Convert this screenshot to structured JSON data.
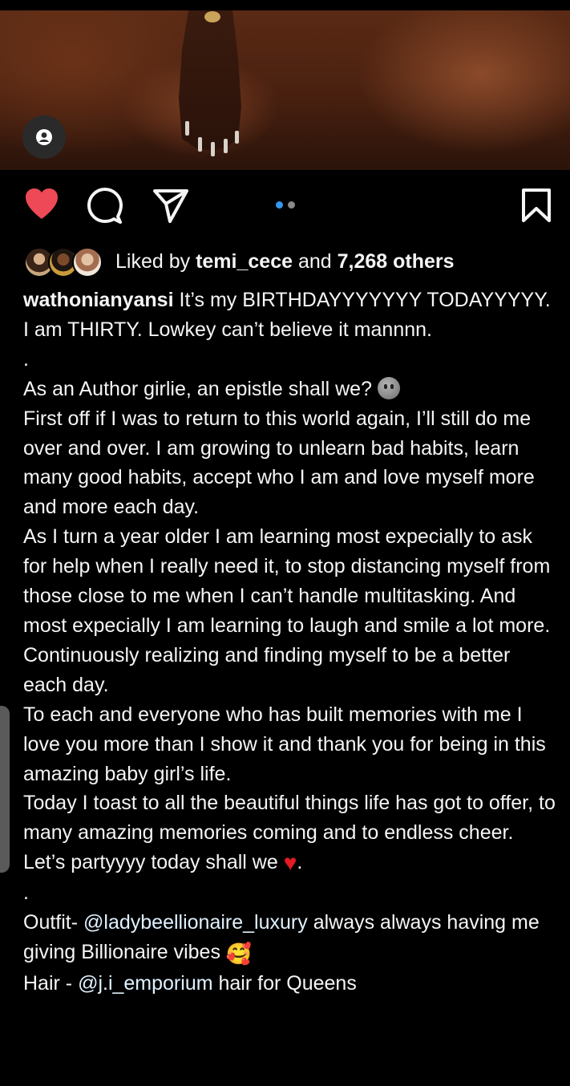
{
  "post": {
    "liked_by_prefix": "Liked by",
    "liked_by_user": "temi_cece",
    "and_text": "and",
    "others_count": "7,268 others",
    "carousel_dots": 2,
    "active_dot": 1
  },
  "caption": {
    "username": "wathonianyansi",
    "line1": "It’s my BIRTHDAYYYYYYY TODAYYYYY. I am THIRTY. Lowkey can’t believe it mannnn.",
    "dot1": ".",
    "line2": "As an Author girlie, an epistle shall we?",
    "line3": "First off if I was to return to this world again, I’ll still do me over and over. I am growing to unlearn bad habits, learn many good habits, accept who I am and love myself more and more each day.",
    "line4": "As I turn a year older I am learning most expecially to ask for help when I really need it, to stop distancing myself from those close to me when I can’t handle multitasking. And most expecially I am learning to laugh and smile a lot more.",
    "line5": "Continuously realizing and finding myself to be a better each day.",
    "line6": "To each and everyone who has built memories with me I love you more than I show it and thank you for being in this amazing baby girl’s life.",
    "line7": "Today I toast to all the beautiful things life has got to offer, to many amazing memories coming and to endless cheer.",
    "line8": "Let’s partyyyy today shall we",
    "line8_end": ".",
    "dot2": ".",
    "outfit_prefix": "Outfit-",
    "outfit_mention": "@ladybeellionaire_luxury",
    "outfit_suffix": "always always having me giving Billionaire vibes",
    "hair_prefix": "Hair -",
    "hair_mention": "@j.i_emporium",
    "hair_suffix": "hair for Queens"
  },
  "icons": {
    "like": "heart-icon-filled",
    "comment": "comment-icon",
    "share": "send-icon",
    "save": "bookmark-icon",
    "tag": "user-tag-icon"
  },
  "colors": {
    "like_red": "#ed4956",
    "active_dot": "#3797f0",
    "inactive_dot": "#8a8a8a",
    "background": "#000000",
    "text": "#f5f5f5"
  }
}
